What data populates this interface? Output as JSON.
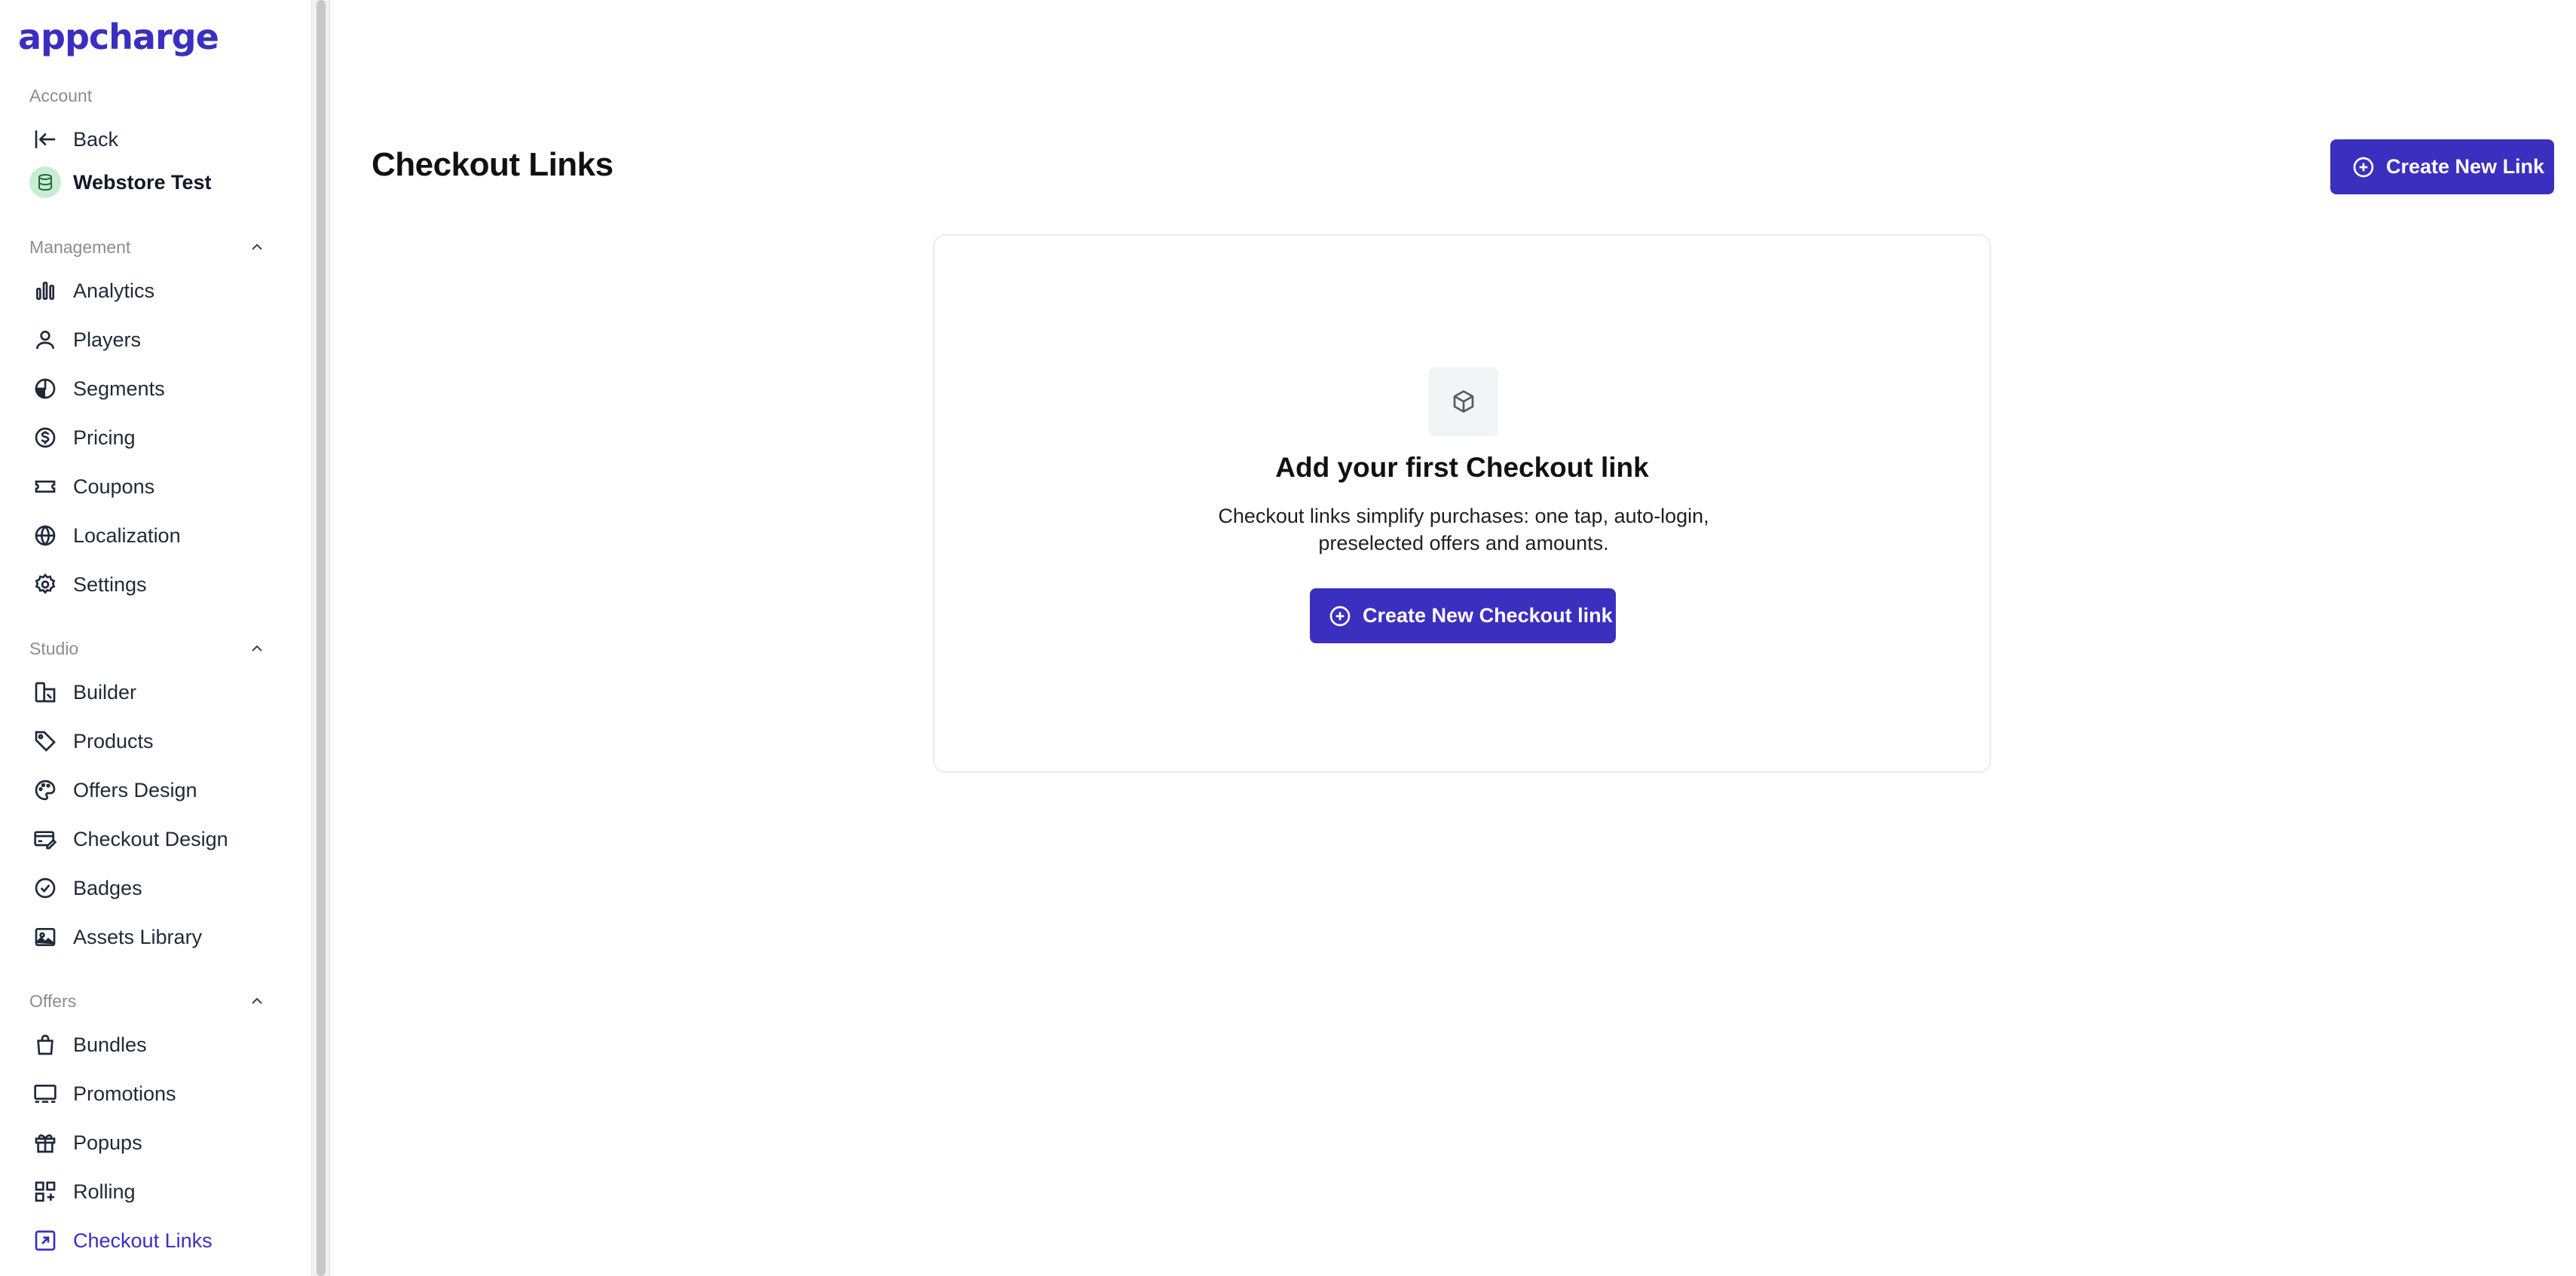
{
  "brand": {
    "logo_text": "appcharge",
    "accent": "#3b2fc0"
  },
  "sidebar": {
    "account_label": "Account",
    "back_label": "Back",
    "workspace_label": "Webstore Test",
    "management": {
      "label": "Management",
      "items": [
        {
          "label": "Analytics",
          "icon": "bar-chart-icon"
        },
        {
          "label": "Players",
          "icon": "user-icon"
        },
        {
          "label": "Segments",
          "icon": "pie-icon"
        },
        {
          "label": "Pricing",
          "icon": "dollar-circle-icon"
        },
        {
          "label": "Coupons",
          "icon": "ticket-icon"
        },
        {
          "label": "Localization",
          "icon": "globe-icon"
        },
        {
          "label": "Settings",
          "icon": "gear-icon"
        }
      ]
    },
    "studio": {
      "label": "Studio",
      "items": [
        {
          "label": "Builder",
          "icon": "builder-icon"
        },
        {
          "label": "Products",
          "icon": "tag-icon"
        },
        {
          "label": "Offers Design",
          "icon": "palette-icon"
        },
        {
          "label": "Checkout Design",
          "icon": "card-edit-icon"
        },
        {
          "label": "Badges",
          "icon": "badge-check-icon"
        },
        {
          "label": "Assets Library",
          "icon": "image-icon"
        }
      ]
    },
    "offers": {
      "label": "Offers",
      "items": [
        {
          "label": "Bundles",
          "icon": "bag-icon"
        },
        {
          "label": "Promotions",
          "icon": "promotion-icon"
        },
        {
          "label": "Popups",
          "icon": "gift-icon"
        },
        {
          "label": "Rolling",
          "icon": "grid-plus-icon"
        },
        {
          "label": "Checkout Links",
          "icon": "link-square-icon"
        }
      ]
    }
  },
  "main": {
    "title": "Checkout Links",
    "create_button": "Create New Link",
    "empty_state": {
      "icon": "box-icon",
      "title": "Add your first Checkout link",
      "description_line1": "Checkout links simplify purchases: one tap, auto-login,",
      "description_line2": "preselected offers and amounts.",
      "button": "Create New Checkout link"
    }
  }
}
